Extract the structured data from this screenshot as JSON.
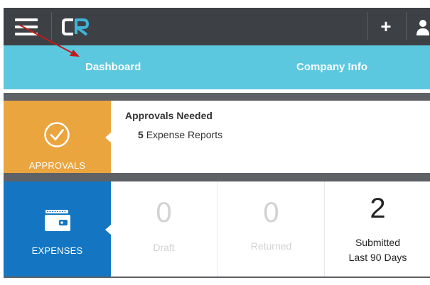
{
  "header": {
    "menu_icon": "hamburger-menu-icon",
    "logo_text": "CR",
    "add_icon": "plus-icon",
    "user_icon": "user-icon",
    "add_label": "+"
  },
  "tabs": [
    {
      "label": "Dashboard"
    },
    {
      "label": "Company Info"
    }
  ],
  "approvals": {
    "tile_label": "APPROVALS",
    "icon": "check-circle-icon",
    "title": "Approvals Needed",
    "count": "5",
    "count_label": "Expense Reports"
  },
  "expenses": {
    "tile_label": "EXPENSES",
    "icon": "wallet-icon",
    "stats": [
      {
        "value": "0",
        "label": "Draft",
        "label2": ""
      },
      {
        "value": "0",
        "label": "Returned",
        "label2": ""
      },
      {
        "value": "2",
        "label": "Submitted",
        "label2": "Last 90 Days"
      }
    ]
  },
  "colors": {
    "topbar": "#3d4045",
    "tabbar": "#5cc8df",
    "approvals_tile": "#eaa53f",
    "expenses_tile": "#1476c2",
    "annotation_arrow": "#c41a1a"
  }
}
